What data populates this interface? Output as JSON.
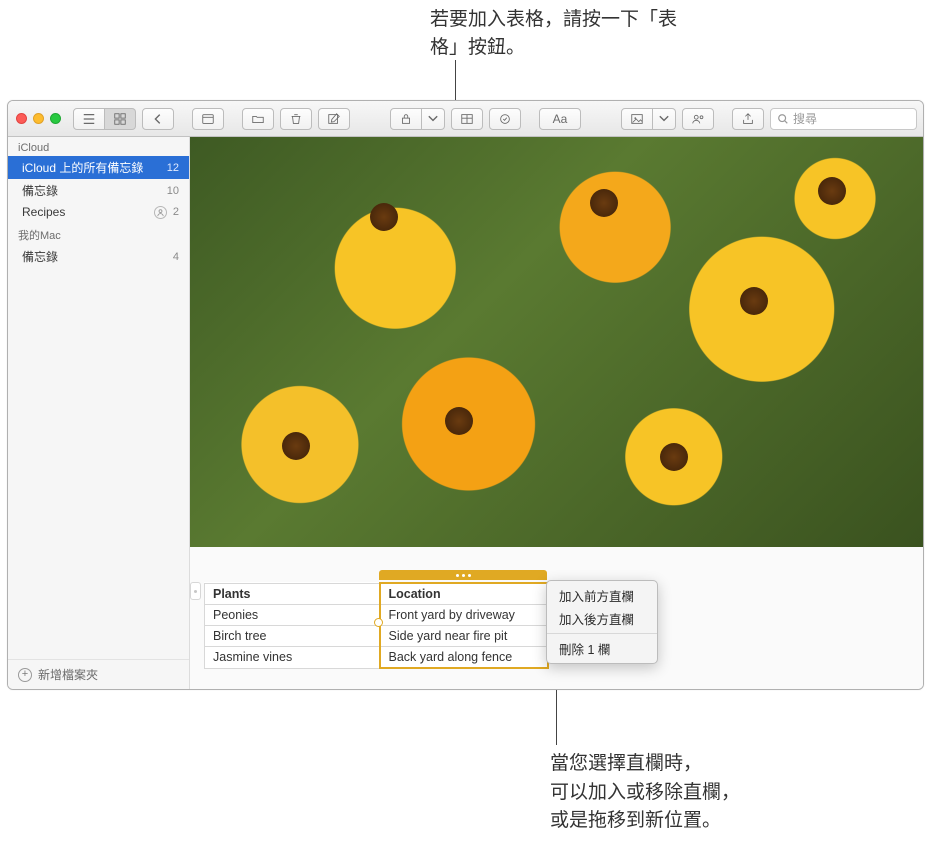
{
  "callouts": {
    "top": "若要加入表格，請按一下「表格」按鈕。",
    "bottom_l1": "當您選擇直欄時，",
    "bottom_l2": "可以加入或移除直欄，",
    "bottom_l3": "或是拖移到新位置。"
  },
  "toolbar": {
    "search_placeholder": "搜尋"
  },
  "sidebar": {
    "group1": "iCloud",
    "items1": [
      {
        "label": "iCloud 上的所有備忘錄",
        "count": "12",
        "selected": true
      },
      {
        "label": "備忘錄",
        "count": "10"
      },
      {
        "label": "Recipes",
        "count": "2",
        "shared": true
      }
    ],
    "group2": "我的Mac",
    "items2": [
      {
        "label": "備忘錄",
        "count": "4"
      }
    ],
    "footer": "新增檔案夾"
  },
  "table": {
    "headers": [
      "Plants",
      "Location"
    ],
    "rows": [
      [
        "Peonies",
        "Front yard by driveway"
      ],
      [
        "Birch tree",
        "Side yard near fire pit"
      ],
      [
        "Jasmine vines",
        "Back yard along fence"
      ]
    ]
  },
  "menu": {
    "add_before": "加入前方直欄",
    "add_after": "加入後方直欄",
    "delete": "刪除 1 欄"
  }
}
